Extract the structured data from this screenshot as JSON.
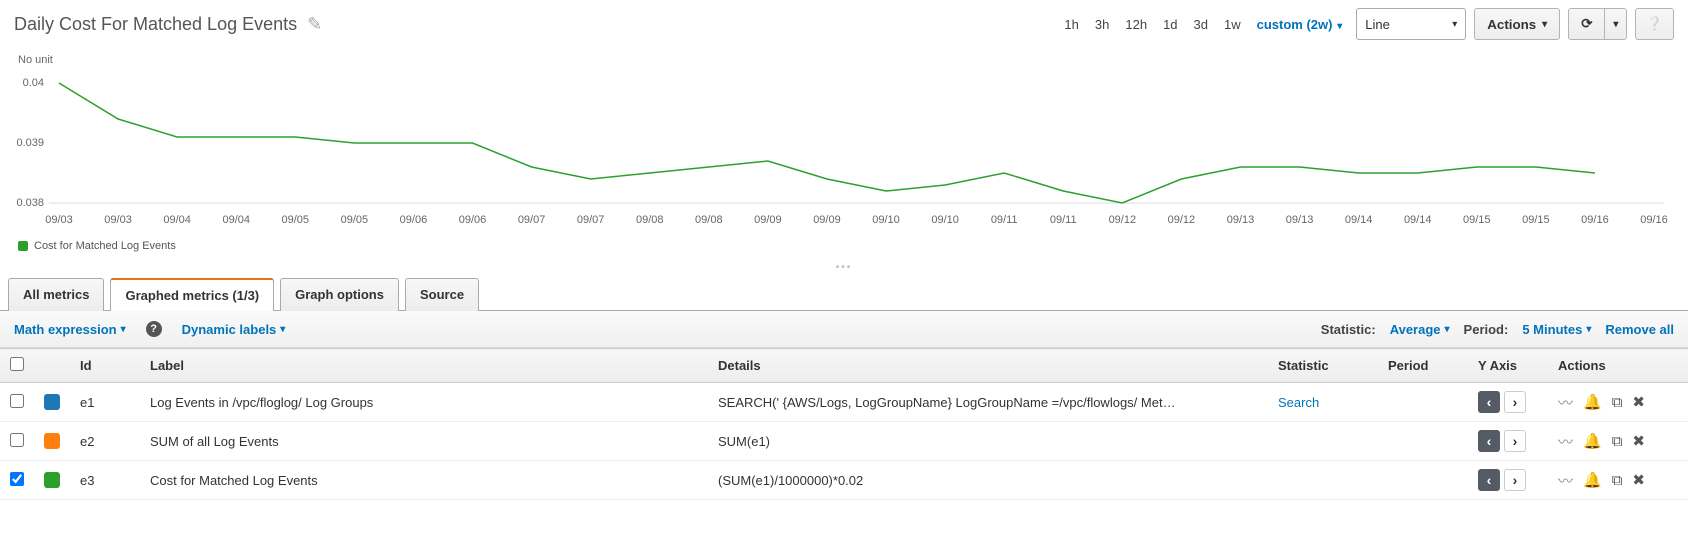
{
  "header": {
    "title": "Daily Cost For Matched Log Events",
    "ranges": [
      "1h",
      "3h",
      "12h",
      "1d",
      "3d",
      "1w"
    ],
    "custom": "custom (2w)",
    "chartType": "Line",
    "actions": "Actions"
  },
  "chart_data": {
    "type": "line",
    "title": "",
    "ylabel": "No unit",
    "ylim": [
      0.038,
      0.04
    ],
    "yticks": [
      0.04,
      0.039,
      0.038
    ],
    "categories": [
      "09/03",
      "09/03",
      "09/04",
      "09/04",
      "09/05",
      "09/05",
      "09/06",
      "09/06",
      "09/07",
      "09/07",
      "09/08",
      "09/08",
      "09/09",
      "09/09",
      "09/10",
      "09/10",
      "09/11",
      "09/11",
      "09/12",
      "09/12",
      "09/13",
      "09/13",
      "09/14",
      "09/14",
      "09/15",
      "09/15",
      "09/16",
      "09/16"
    ],
    "series": [
      {
        "name": "Cost for Matched Log Events",
        "color": "#2ca02c",
        "values": [
          0.04,
          0.0394,
          0.0391,
          0.0391,
          0.0391,
          0.039,
          0.039,
          0.039,
          0.0386,
          0.0384,
          0.0385,
          0.0386,
          0.0387,
          0.0384,
          0.0382,
          0.0383,
          0.0385,
          0.0382,
          0.038,
          0.0384,
          0.0386,
          0.0386,
          0.0385,
          0.0385,
          0.0386,
          0.0386,
          0.0385,
          null
        ]
      }
    ]
  },
  "legend": "Cost for Matched Log Events",
  "tabs": {
    "all": "All metrics",
    "graphed": "Graphed metrics (1/3)",
    "options": "Graph options",
    "source": "Source"
  },
  "subbar": {
    "math": "Math expression",
    "dynamic": "Dynamic labels",
    "statistic_label": "Statistic:",
    "statistic_value": "Average",
    "period_label": "Period:",
    "period_value": "5 Minutes",
    "remove_all": "Remove all"
  },
  "table": {
    "headers": {
      "id": "Id",
      "label": "Label",
      "details": "Details",
      "statistic": "Statistic",
      "period": "Period",
      "yaxis": "Y Axis",
      "actions": "Actions"
    },
    "rows": [
      {
        "checked": false,
        "color": "#1f77b4",
        "id": "e1",
        "label": "Log Events in /vpc/floglog/ Log Groups",
        "details": "SEARCH(' {AWS/Logs, LogGroupName} LogGroupName =/vpc/flowlogs/ Met…",
        "statistic": "Search",
        "period": "",
        "yaxis": "<"
      },
      {
        "checked": false,
        "color": "#ff7f0e",
        "id": "e2",
        "label": "SUM of all Log Events",
        "details": "SUM(e1)",
        "statistic": "",
        "period": "",
        "yaxis": "<"
      },
      {
        "checked": true,
        "color": "#2ca02c",
        "id": "e3",
        "label": "Cost for Matched Log Events",
        "details": "(SUM(e1)/1000000)*0.02",
        "statistic": "",
        "period": "",
        "yaxis": "<"
      }
    ]
  }
}
